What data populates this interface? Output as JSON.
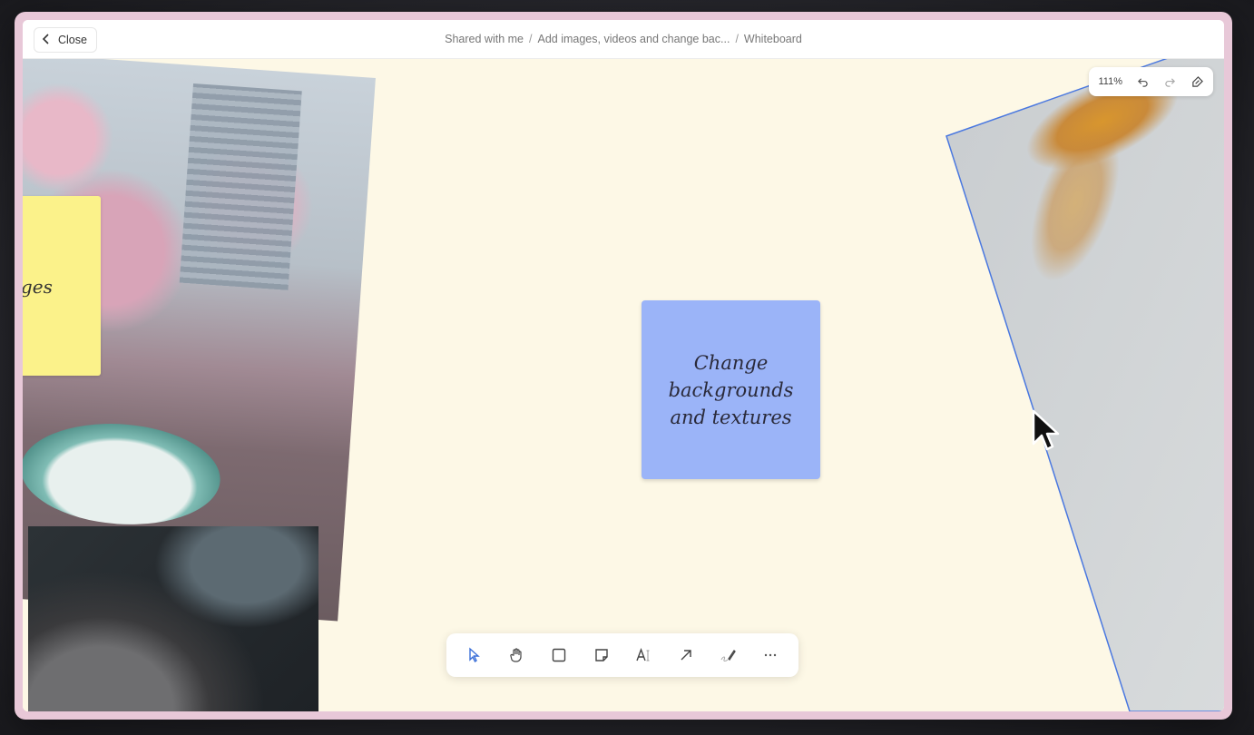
{
  "topbar": {
    "close_label": "Close",
    "breadcrumb": [
      "Shared with me",
      "Add images, videos and change bac...",
      "Whiteboard"
    ]
  },
  "zoom": {
    "level": "111%"
  },
  "stickies": {
    "yellow_text": "ages",
    "blue_text": "Change\nbackgrounds\nand textures"
  },
  "toolbar": {
    "tools": [
      "select",
      "hand",
      "shape",
      "sticky-note",
      "text",
      "arrow",
      "pen",
      "more"
    ]
  },
  "colors": {
    "canvas": "#fdf8e6",
    "sticky_blue": "#9bb4f8",
    "sticky_yellow": "#fbf28a",
    "accent": "#3b6fd8"
  }
}
